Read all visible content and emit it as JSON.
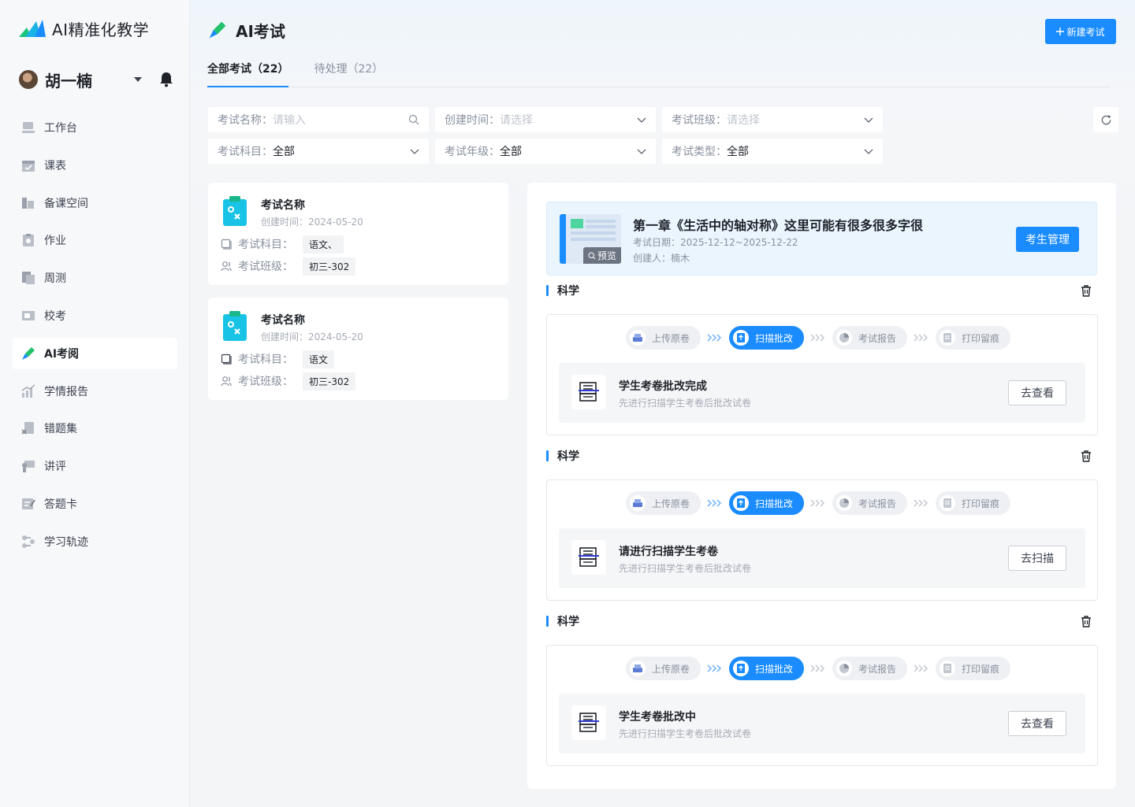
{
  "app": {
    "title": "AI精准化教学"
  },
  "user": {
    "name": "胡一楠"
  },
  "nav": {
    "items": [
      {
        "label": "工作台"
      },
      {
        "label": "课表"
      },
      {
        "label": "备课空间"
      },
      {
        "label": "作业"
      },
      {
        "label": "周测"
      },
      {
        "label": "校考"
      },
      {
        "label": "AI考阅"
      },
      {
        "label": "学情报告"
      },
      {
        "label": "错题集"
      },
      {
        "label": "讲评"
      },
      {
        "label": "答题卡"
      },
      {
        "label": "学习轨迹"
      }
    ]
  },
  "header": {
    "title": "AI考试",
    "new_button": "新建考试"
  },
  "tabs": [
    {
      "label": "全部考试（22）"
    },
    {
      "label": "待处理（22）"
    }
  ],
  "filters": {
    "name": {
      "label": "考试名称：",
      "placeholder": "请输入"
    },
    "created": {
      "label": "创建时间：",
      "placeholder": "请选择"
    },
    "class": {
      "label": "考试班级：",
      "placeholder": "请选择"
    },
    "subject": {
      "label": "考试科目：",
      "value": "全部"
    },
    "grade": {
      "label": "考试年级：",
      "value": "全部"
    },
    "type": {
      "label": "考试类型：",
      "value": "全部"
    }
  },
  "exam_list": [
    {
      "title": "考试名称",
      "date": "创建时间：2024-05-20",
      "subject_label": "考试科目：",
      "subject": "语文、",
      "class_label": "考试班级：",
      "class": "初三-302"
    },
    {
      "title": "考试名称",
      "date": "创建时间：2024-05-20",
      "subject_label": "考试科目：",
      "subject": "语文",
      "class_label": "考试班级：",
      "class": "初三-302"
    }
  ],
  "detail": {
    "title": "第一章《生活中的轴对称》这里可能有很多很多字很",
    "date": "考试日期：2025-12-12~2025-12-22",
    "creator": "创建人：楠木",
    "preview": "预览",
    "students_button": "考生管理",
    "steps": [
      "上传原卷",
      "扫描批改",
      "考试报告",
      "打印留痕"
    ],
    "active_step": 1,
    "subjects": [
      {
        "name": "科学",
        "status_title": "学生考卷批改完成",
        "status_desc": "先进行扫描学生考卷后批改试卷",
        "action": "去查看"
      },
      {
        "name": "科学",
        "status_title": "请进行扫描学生考卷",
        "status_desc": "先进行扫描学生考卷后批改试卷",
        "action": "去扫描"
      },
      {
        "name": "科学",
        "status_title": "学生考卷批改中",
        "status_desc": "先进行扫描学生考卷后批改试卷",
        "action": "去查看"
      }
    ]
  },
  "colors": {
    "accent": "#1a8cff",
    "brand_green": "#23c16b"
  }
}
